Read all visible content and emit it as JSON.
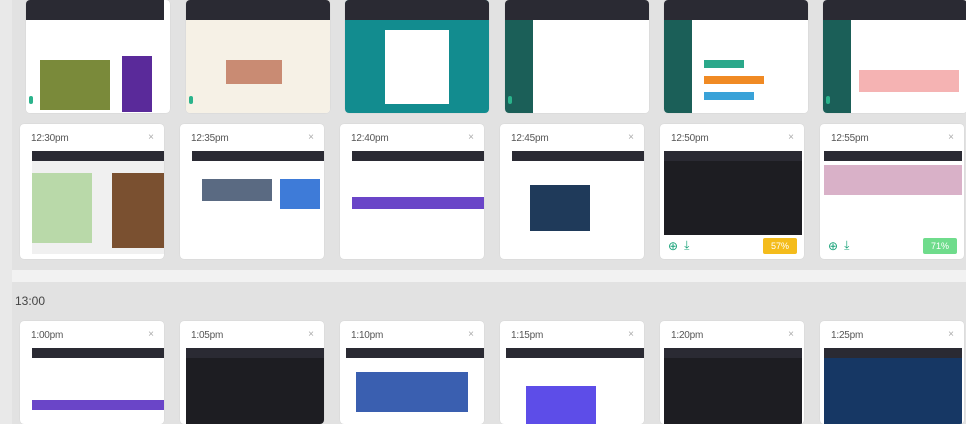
{
  "row_top_partial": {
    "cards": [
      {
        "id": "c1",
        "image_desc": "article-page"
      },
      {
        "id": "c2",
        "image_desc": "email-page"
      },
      {
        "id": "c3",
        "image_desc": "teal-login"
      },
      {
        "id": "c4",
        "image_desc": "table-dashboard"
      },
      {
        "id": "c5",
        "image_desc": "bar-dashboard"
      },
      {
        "id": "c6",
        "image_desc": "chart-dashboard"
      }
    ]
  },
  "row_1230": {
    "cards": [
      {
        "time": "12:30pm"
      },
      {
        "time": "12:35pm"
      },
      {
        "time": "12:40pm"
      },
      {
        "time": "12:45pm"
      },
      {
        "time": "12:50pm",
        "badge": "57%",
        "badge_color": "#f4bc1c"
      },
      {
        "time": "12:55pm",
        "badge": "71%",
        "badge_color": "#6fdc8c"
      }
    ]
  },
  "hour_block": {
    "label": "13:00"
  },
  "row_100": {
    "cards": [
      {
        "time": "1:00pm"
      },
      {
        "time": "1:05pm"
      },
      {
        "time": "1:10pm"
      },
      {
        "time": "1:15pm"
      },
      {
        "time": "1:20pm"
      },
      {
        "time": "1:25pm"
      }
    ]
  },
  "icons": {
    "close": "×",
    "zoom": "⊕",
    "download": "⤓"
  }
}
